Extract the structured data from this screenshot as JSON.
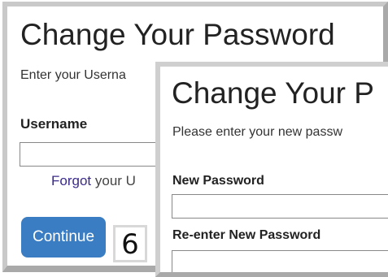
{
  "screen1": {
    "title": "Change Your Password",
    "intro": "Enter your Userna",
    "username_label": "Username",
    "username_value": "",
    "forgot_link": "Forgot",
    "forgot_rest": " your U",
    "continue_label": "Continue"
  },
  "step_badge": "6",
  "screen2": {
    "title": "Change Your P",
    "intro": "Please enter your new passw",
    "new_password_label": "New Password",
    "new_password_value": "",
    "reenter_label": "Re-enter New Password",
    "reenter_value": ""
  }
}
